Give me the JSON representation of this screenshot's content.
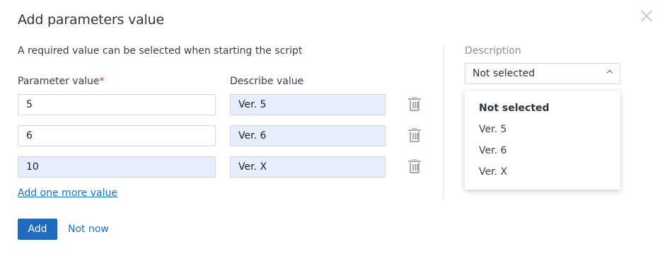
{
  "dialog": {
    "title": "Add parameters value",
    "subtitle": "A required value can be selected when starting the script"
  },
  "columns": {
    "param_label": "Parameter value",
    "required_mark": "*",
    "describe_label": "Describe value"
  },
  "rows": [
    {
      "value": "5",
      "description": "Ver. 5"
    },
    {
      "value": "6",
      "description": "Ver. 6"
    },
    {
      "value": "10",
      "description": "Ver. X"
    }
  ],
  "add_more_link": "Add one more value",
  "buttons": {
    "add": "Add",
    "not_now": "Not now"
  },
  "description_panel": {
    "label": "Description",
    "selected": "Not selected",
    "options": [
      "Not selected",
      "Ver. 5",
      "Ver. 6",
      "Ver. X"
    ]
  },
  "colors": {
    "primary": "#1f6bc1",
    "link": "#1e6fbf",
    "required": "#d0323a",
    "filled_input": "#e8edfb"
  },
  "icons": [
    "close-icon",
    "trash-icon",
    "chevron-up-icon"
  ]
}
